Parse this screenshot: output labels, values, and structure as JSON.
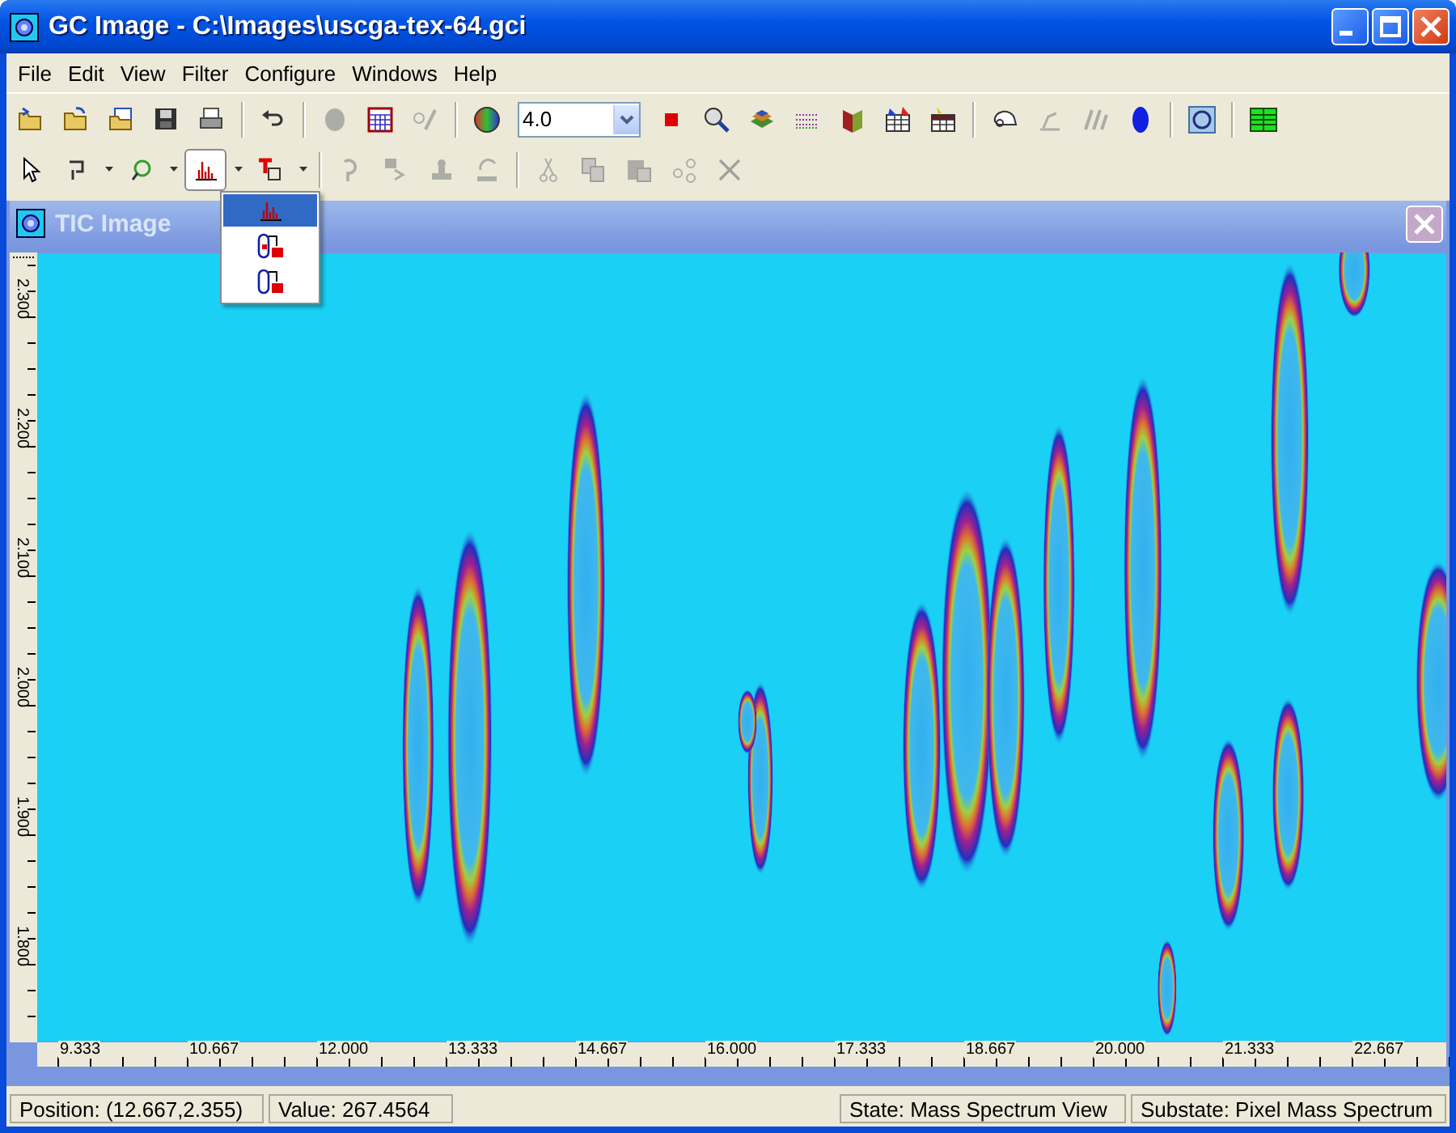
{
  "window": {
    "title": "GC Image - C:\\Images\\uscga-tex-64.gci"
  },
  "menu": [
    "File",
    "Edit",
    "View",
    "Filter",
    "Configure",
    "Windows",
    "Help"
  ],
  "toolbar_1": [
    {
      "kind": "button",
      "disabled": false
    },
    {
      "kind": "button",
      "disabled": false
    },
    {
      "kind": "button",
      "disabled": false
    },
    {
      "kind": "button",
      "disabled": false
    },
    {
      "kind": "button",
      "disabled": false
    },
    {
      "kind": "separator"
    },
    {
      "kind": "button",
      "disabled": false
    },
    {
      "kind": "separator"
    },
    {
      "kind": "button",
      "disabled": true
    },
    {
      "kind": "button",
      "disabled": false
    },
    {
      "kind": "button",
      "disabled": true
    },
    {
      "kind": "separator"
    },
    {
      "kind": "button",
      "disabled": false
    },
    {
      "kind": "combo",
      "value": "4.0"
    },
    {
      "kind": "button",
      "disabled": false
    },
    {
      "kind": "button",
      "disabled": false
    },
    {
      "kind": "button",
      "disabled": false
    },
    {
      "kind": "button",
      "disabled": false
    },
    {
      "kind": "button",
      "disabled": false
    },
    {
      "kind": "button",
      "disabled": false
    },
    {
      "kind": "button",
      "disabled": false
    },
    {
      "kind": "separator"
    },
    {
      "kind": "button",
      "disabled": false
    },
    {
      "kind": "button",
      "disabled": true
    },
    {
      "kind": "button",
      "disabled": true
    },
    {
      "kind": "button",
      "disabled": false
    },
    {
      "kind": "separator"
    },
    {
      "kind": "button",
      "disabled": false
    },
    {
      "kind": "separator"
    },
    {
      "kind": "button",
      "disabled": false
    }
  ],
  "toolbar_2": [
    {
      "kind": "button",
      "disabled": false,
      "pressed": false
    },
    {
      "kind": "split",
      "disabled": false,
      "pressed": false
    },
    {
      "kind": "split",
      "disabled": false,
      "pressed": false
    },
    {
      "kind": "split",
      "disabled": false,
      "pressed": true
    },
    {
      "kind": "split",
      "disabled": false,
      "pressed": false
    },
    {
      "kind": "separator"
    },
    {
      "kind": "button",
      "disabled": true,
      "pressed": false
    },
    {
      "kind": "button",
      "disabled": true,
      "pressed": false
    },
    {
      "kind": "button",
      "disabled": true,
      "pressed": false
    },
    {
      "kind": "button",
      "disabled": true,
      "pressed": false
    },
    {
      "kind": "separator"
    },
    {
      "kind": "button",
      "disabled": true,
      "pressed": false
    },
    {
      "kind": "button",
      "disabled": true,
      "pressed": false
    },
    {
      "kind": "button",
      "disabled": true,
      "pressed": false
    },
    {
      "kind": "button",
      "disabled": true,
      "pressed": false
    },
    {
      "kind": "button",
      "disabled": true,
      "pressed": false
    }
  ],
  "dropdown_menu": [
    {
      "selected": true
    },
    {
      "selected": false
    },
    {
      "selected": false
    }
  ],
  "image_window": {
    "title": "TIC Image",
    "y_axis_labels": [
      "2.300",
      "2.200",
      "2.100",
      "2.000",
      "1.900",
      "1.800"
    ],
    "x_axis_labels": [
      "9.333",
      "10.667",
      "12.000",
      "13.333",
      "14.667",
      "16.000",
      "17.333",
      "18.667",
      "20.000",
      "21.333",
      "22.667"
    ]
  },
  "status_bar": {
    "position": "Position: (12.667,2.355)",
    "value": "Value: 267.4564",
    "state": "State: Mass Spectrum View",
    "substate": "Substate: Pixel Mass Spectrum"
  }
}
